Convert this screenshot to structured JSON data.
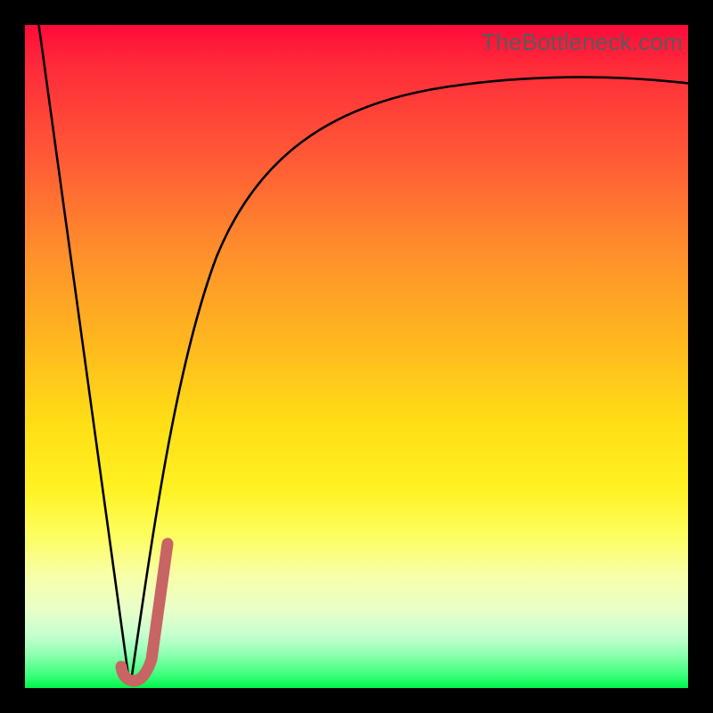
{
  "watermark": "TheBottleneck.com",
  "colors": {
    "gradient_top": "#ff0a3a",
    "gradient_bottom": "#00f54b",
    "curve": "#000000",
    "hook": "#c86464",
    "frame": "#000000"
  },
  "chart_data": {
    "type": "line",
    "title": "",
    "xlabel": "",
    "ylabel": "",
    "xlim": [
      0,
      100
    ],
    "ylim": [
      0,
      100
    ],
    "grid": false,
    "legend": false,
    "series": [
      {
        "name": "left-descent",
        "x": [
          2,
          15.5
        ],
        "values": [
          100,
          2
        ]
      },
      {
        "name": "right-saturating-curve",
        "x": [
          16,
          18,
          20,
          22,
          25,
          28,
          32,
          37,
          43,
          50,
          58,
          67,
          77,
          88,
          100
        ],
        "values": [
          2,
          11,
          22,
          32,
          45,
          55,
          64,
          71,
          77,
          81,
          84,
          86.5,
          88.5,
          90,
          91
        ]
      },
      {
        "name": "j-hook-overlay",
        "x": [
          14.5,
          15.2,
          16.2,
          17.5,
          19,
          20.3,
          21.3
        ],
        "values": [
          2.5,
          1.2,
          1.0,
          2.8,
          8.5,
          15,
          21
        ]
      }
    ],
    "annotations": []
  }
}
